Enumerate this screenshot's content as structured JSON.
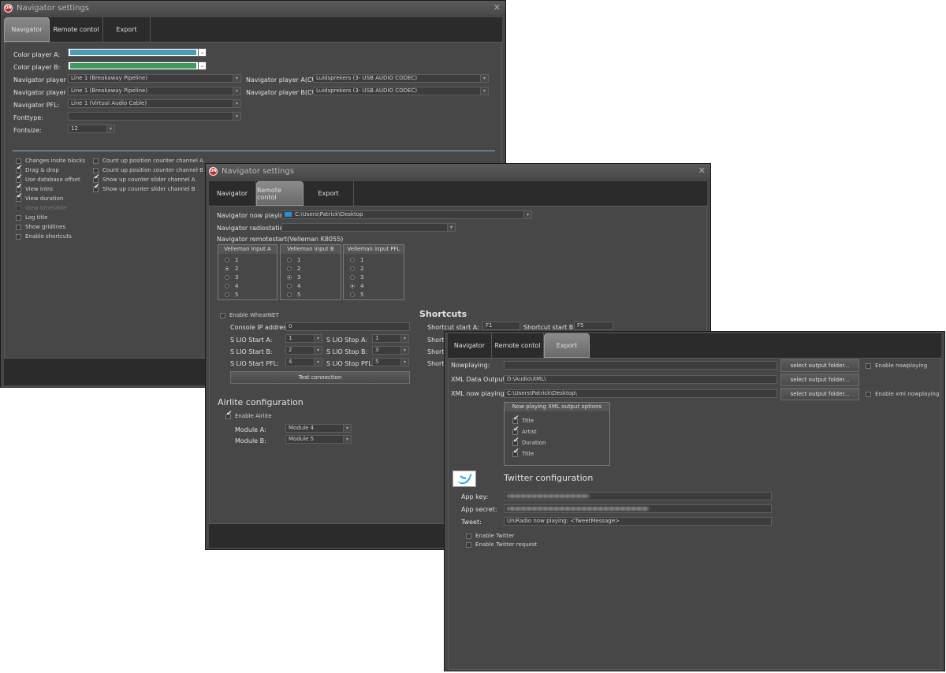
{
  "win1": {
    "title": "Navigator settings",
    "tabs": [
      "Navigator",
      "Remote contol",
      "Export"
    ],
    "color_player_a_label": "Color player A:",
    "color_player_b_label": "Color player B:",
    "color_player_a": "#4a9ab8",
    "color_player_b": "#3f9a5e",
    "nav_player_a_label": "Navigator player A:",
    "nav_player_a_value": "Line 1 (Breakaway Pipeline)",
    "nav_player_b_label": "Navigator player B:",
    "nav_player_b_value": "Line 1 (Breakaway Pipeline)",
    "nav_pfl_label": "Navigator PFL:",
    "nav_pfl_value": "Line 1 (Virtual Audio Cable)",
    "fonttype_label": "Fonttype:",
    "fonttype_value": "",
    "fontsize_label": "Fontsize:",
    "fontsize_value": "12",
    "cue_a_label": "Navigator player A(CUE):",
    "cue_a_value": "Luidsprekers (3- USB AUDIO  CODEC)",
    "cue_b_label": "Navigator player B(CUE):",
    "cue_b_value": "Luidsprekers (3- USB AUDIO  CODEC)",
    "left_checks": [
      {
        "label": "Changes insite blocks",
        "checked": false,
        "disabled": false
      },
      {
        "label": "Drag & drop",
        "checked": true,
        "disabled": false
      },
      {
        "label": "Use database offset",
        "checked": true,
        "disabled": false
      },
      {
        "label": "View intro",
        "checked": true,
        "disabled": false
      },
      {
        "label": "View duration",
        "checked": true,
        "disabled": false
      },
      {
        "label": "View timetable",
        "checked": false,
        "disabled": true
      },
      {
        "label": "Log title",
        "checked": false,
        "disabled": false
      },
      {
        "label": "Show gridlines",
        "checked": false,
        "disabled": false
      },
      {
        "label": "Enable shortcuts",
        "checked": false,
        "disabled": false
      }
    ],
    "right_checks": [
      {
        "label": "Count up position counter channel A",
        "checked": false
      },
      {
        "label": "Count up position counter channel B",
        "checked": false
      },
      {
        "label": "Show up counter slider channel A",
        "checked": true
      },
      {
        "label": "Show up counter slider channel B",
        "checked": true
      }
    ]
  },
  "win2": {
    "title": "Navigator settings",
    "tabs": [
      "Navigator",
      "Remote contol",
      "Export"
    ],
    "now_playing_label": "Navigator now playing:",
    "now_playing_value": "C:\\Users\\Patrick\\Desktop",
    "radiostation_label": "Navigator radiostation:",
    "radiostation_value": "",
    "remotestart_label": "Navigator remotestart(Velleman K8055)",
    "groups": [
      {
        "title": "Velleman input A",
        "options": [
          "1",
          "2",
          "3",
          "4",
          "5"
        ],
        "selected": 1
      },
      {
        "title": "Velleman input B",
        "options": [
          "1",
          "2",
          "3",
          "4",
          "5"
        ],
        "selected": 2
      },
      {
        "title": "Velleman input PFL",
        "options": [
          "1",
          "2",
          "3",
          "4",
          "5"
        ],
        "selected": 3
      }
    ],
    "enable_wheatnet": "Enable WheatNET",
    "console_ip_label": "Console IP address:",
    "console_ip_value": "0",
    "slio_start_a_label": "S LIO Start A:",
    "slio_start_a": "1",
    "slio_start_b_label": "S LIO Start B:",
    "slio_start_b": "2",
    "slio_start_pfl_label": "S LIO Start PFL:",
    "slio_start_pfl": "4",
    "slio_stop_a_label": "S LIO Stop A:",
    "slio_stop_a": "1",
    "slio_stop_b_label": "S LIO Stop B:",
    "slio_stop_b": "3",
    "slio_stop_pfl_label": "S LIO Stop PFL:",
    "slio_stop_pfl": "5",
    "test_connection": "Test connection",
    "shortcuts_title": "Shortcuts",
    "shortcut_start_a_label": "Shortcut start A:",
    "shortcut_start_a": "F1",
    "shortcut_start_b_label": "Shortcut start B:",
    "shortcut_start_b": "F5",
    "shortcut_cut_1": "Shortc",
    "shortcut_cut_2": "Shortc",
    "shortcut_cut_3": "Shortc",
    "airlite_title": "Airlite configuration",
    "enable_airlite": "Enable Airlite",
    "module_a_label": "Module A:",
    "module_a_value": "Module 4",
    "module_b_label": "Module B:",
    "module_b_value": "Module 5"
  },
  "win3": {
    "tabs": [
      "Navigator",
      "Remote contol",
      "Export"
    ],
    "nowplaying_label": "Nowplaying:",
    "nowplaying_value": "",
    "xml_data_label": "XML Data Output:",
    "xml_data_value": "D:\\Audio\\XML\\",
    "xml_now_label": "XML now playing:",
    "xml_now_value": "C:\\Users\\Patrick\\Desktop\\",
    "select_folder": "select output folder...",
    "enable_nowplaying": "Enable nowplaying",
    "enable_xml_nowplaying": "Enable xml nowplaying",
    "xml_options_title": "Now playing XML output options",
    "xml_options": [
      "Title",
      "Artist",
      "Duration",
      "Title"
    ],
    "twitter_title": "Twitter configuration",
    "app_key_label": "App key:",
    "app_secret_label": "App secret:",
    "tweet_label": "Tweet:",
    "tweet_value": "UniRadio now playing: <TweetMessage>",
    "enable_twitter": "Enable Twitter",
    "enable_twitter_request": "Enable Twitter request"
  }
}
